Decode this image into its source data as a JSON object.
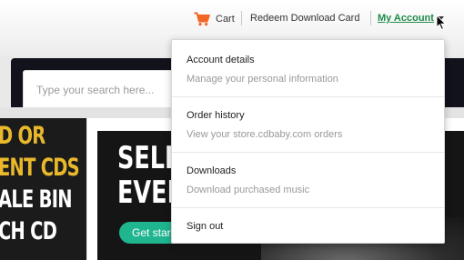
{
  "header": {
    "cart_label": "Cart",
    "redeem_label": "Redeem Download Card",
    "account_label": "My Account"
  },
  "search": {
    "placeholder": "Type your search here..."
  },
  "promo_left": {
    "lines": [
      "D OR",
      "ENT CDS",
      "ALE BIN",
      "CH CD"
    ]
  },
  "promo_right": {
    "line1": "SELL",
    "line2": "EVER",
    "cta": "Get star"
  },
  "account_menu": {
    "items": [
      {
        "title": "Account details",
        "subtitle": "Manage your personal information"
      },
      {
        "title": "Order history",
        "subtitle": "View your store.cdbaby.com orders"
      },
      {
        "title": "Downloads",
        "subtitle": "Download purchased music"
      },
      {
        "title": "Sign out"
      }
    ]
  },
  "colors": {
    "cart_icon": "#f26522",
    "account_link": "#1f8a4a",
    "cta": "#1fb58f",
    "promo_yellow": "#e9b82b"
  },
  "icons": [
    "shopping-cart-icon",
    "chevron-down-icon",
    "mouse-cursor-icon"
  ]
}
